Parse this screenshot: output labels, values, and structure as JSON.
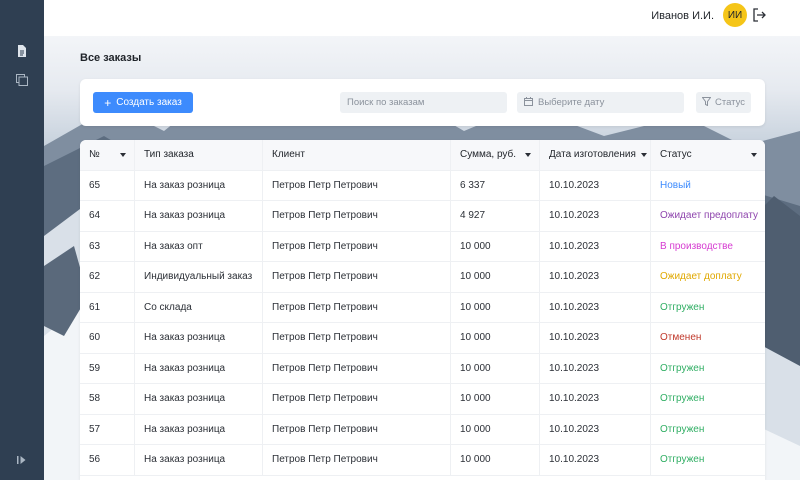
{
  "user": {
    "name": "Иванов И.И.",
    "initials": "ИИ"
  },
  "page": {
    "title": "Все заказы"
  },
  "toolbar": {
    "create_label": "Создать заказ",
    "search_placeholder": "Поиск по заказам",
    "date_placeholder": "Выберите дату",
    "status_label": "Статус"
  },
  "colors": {
    "accent": "#3d8bfd",
    "avatar": "#f5c518",
    "sidebar": "#2f3f52",
    "status_new": "#3d8bfd",
    "status_wait_prepay": "#8e44ad",
    "status_production": "#d63bd1",
    "status_wait_pay": "#e0a800",
    "status_shipped": "#2fae63",
    "status_cancelled": "#c0392b"
  },
  "table": {
    "headers": [
      "№",
      "Тип заказа",
      "Клиент",
      "Сумма, руб.",
      "Дата изготовления",
      "Статус"
    ],
    "rows": [
      {
        "num": "65",
        "type": "На заказ розница",
        "client": "Петров Петр Петрович",
        "sum": "6 337",
        "date": "10.10.2023",
        "status": "Новый",
        "status_color": "#3d8bfd"
      },
      {
        "num": "64",
        "type": "На заказ розница",
        "client": "Петров Петр Петрович",
        "sum": "4 927",
        "date": "10.10.2023",
        "status": "Ожидает предоплату",
        "status_color": "#8e44ad"
      },
      {
        "num": "63",
        "type": "На заказ опт",
        "client": "Петров Петр Петрович",
        "sum": "10 000",
        "date": "10.10.2023",
        "status": "В производстве",
        "status_color": "#d63bd1"
      },
      {
        "num": "62",
        "type": "Индивидуальный заказ",
        "client": "Петров Петр Петрович",
        "sum": "10 000",
        "date": "10.10.2023",
        "status": "Ожидает доплату",
        "status_color": "#e0a800"
      },
      {
        "num": "61",
        "type": "Со склада",
        "client": "Петров Петр Петрович",
        "sum": "10 000",
        "date": "10.10.2023",
        "status": "Отгружен",
        "status_color": "#2fae63"
      },
      {
        "num": "60",
        "type": "На заказ розница",
        "client": "Петров Петр Петрович",
        "sum": "10 000",
        "date": "10.10.2023",
        "status": "Отменен",
        "status_color": "#c0392b"
      },
      {
        "num": "59",
        "type": "На заказ розница",
        "client": "Петров Петр Петрович",
        "sum": "10 000",
        "date": "10.10.2023",
        "status": "Отгружен",
        "status_color": "#2fae63"
      },
      {
        "num": "58",
        "type": "На заказ розница",
        "client": "Петров Петр Петрович",
        "sum": "10 000",
        "date": "10.10.2023",
        "status": "Отгружен",
        "status_color": "#2fae63"
      },
      {
        "num": "57",
        "type": "На заказ розница",
        "client": "Петров Петр Петрович",
        "sum": "10 000",
        "date": "10.10.2023",
        "status": "Отгружен",
        "status_color": "#2fae63"
      },
      {
        "num": "56",
        "type": "На заказ розница",
        "client": "Петров Петр Петрович",
        "sum": "10 000",
        "date": "10.10.2023",
        "status": "Отгружен",
        "status_color": "#2fae63"
      }
    ]
  }
}
